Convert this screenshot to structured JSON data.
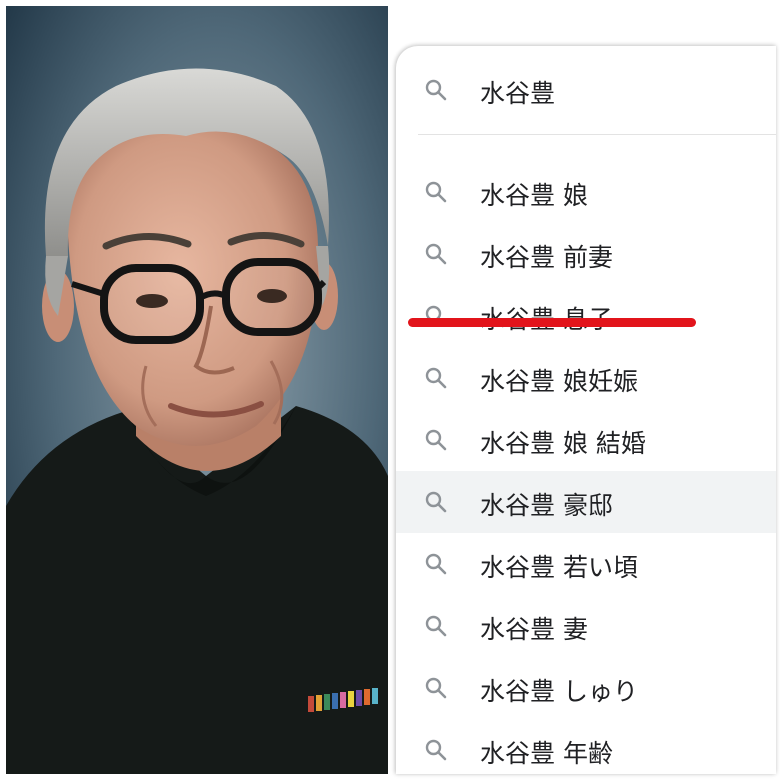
{
  "colors": {
    "accent_underline": "#e2141b",
    "text": "#202124",
    "icon": "#8e9398",
    "highlight_row": "#f1f3f4"
  },
  "search": {
    "query": "水谷豊",
    "icon": "search-icon"
  },
  "suggestions": [
    {
      "text": "水谷豊 娘",
      "icon": "search-icon"
    },
    {
      "text": "水谷豊 前妻",
      "icon": "search-icon"
    },
    {
      "text": "水谷豊 息子",
      "icon": "search-icon",
      "underlined": true
    },
    {
      "text": "水谷豊 娘妊娠",
      "icon": "search-icon"
    },
    {
      "text": "水谷豊 娘 結婚",
      "icon": "search-icon"
    },
    {
      "text": "水谷豊 豪邸",
      "icon": "search-icon",
      "highlighted": true
    },
    {
      "text": "水谷豊 若い頃",
      "icon": "search-icon"
    },
    {
      "text": "水谷豊 妻",
      "icon": "search-icon"
    },
    {
      "text": "水谷豊 しゅり",
      "icon": "search-icon"
    },
    {
      "text": "水谷豊 年齢",
      "icon": "search-icon"
    }
  ]
}
